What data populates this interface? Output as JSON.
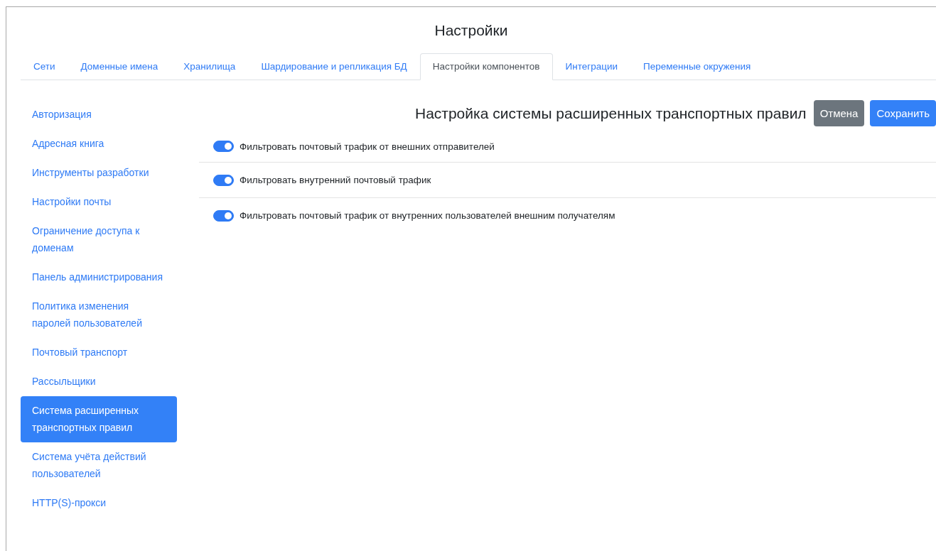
{
  "window": {
    "title": "Настройки"
  },
  "tabs": [
    {
      "label": "Сети",
      "selected": false
    },
    {
      "label": "Доменные имена",
      "selected": false
    },
    {
      "label": "Хранилища",
      "selected": false
    },
    {
      "label": "Шардирование и репликация БД",
      "selected": false
    },
    {
      "label": "Настройки компонентов",
      "selected": true
    },
    {
      "label": "Интеграции",
      "selected": false
    },
    {
      "label": "Переменные окружения",
      "selected": false
    }
  ],
  "sidebar": {
    "items": [
      {
        "label": "Авторизация",
        "selected": false
      },
      {
        "label": "Адресная книга",
        "selected": false
      },
      {
        "label": "Инструменты разработки",
        "selected": false
      },
      {
        "label": "Настройки почты",
        "selected": false
      },
      {
        "label": "Ограничение доступа к доменам",
        "selected": false
      },
      {
        "label": "Панель администрирования",
        "selected": false
      },
      {
        "label": "Политика изменения паролей пользователей",
        "selected": false
      },
      {
        "label": "Почтовый транспорт",
        "selected": false
      },
      {
        "label": "Рассыльщики",
        "selected": false
      },
      {
        "label": "Система расширенных транспортных правил",
        "selected": true
      },
      {
        "label": "Система учёта действий пользователей",
        "selected": false
      },
      {
        "label": "HTTP(S)-прокси",
        "selected": false
      }
    ]
  },
  "panel": {
    "heading": "Настройка системы расширенных транспортных правил",
    "buttons": [
      {
        "label": "Отмена",
        "kind": "secondary"
      },
      {
        "label": "Сохранить",
        "kind": "primary"
      }
    ],
    "toggles": [
      {
        "label": "Фильтровать почтовый трафик от внешних отправителей",
        "on": true
      },
      {
        "label": "Фильтровать внутренний почтовый трафик",
        "on": true
      },
      {
        "label": "Фильтровать почтовый трафик от внутренних пользователей внешним получателям",
        "on": true
      }
    ]
  }
}
